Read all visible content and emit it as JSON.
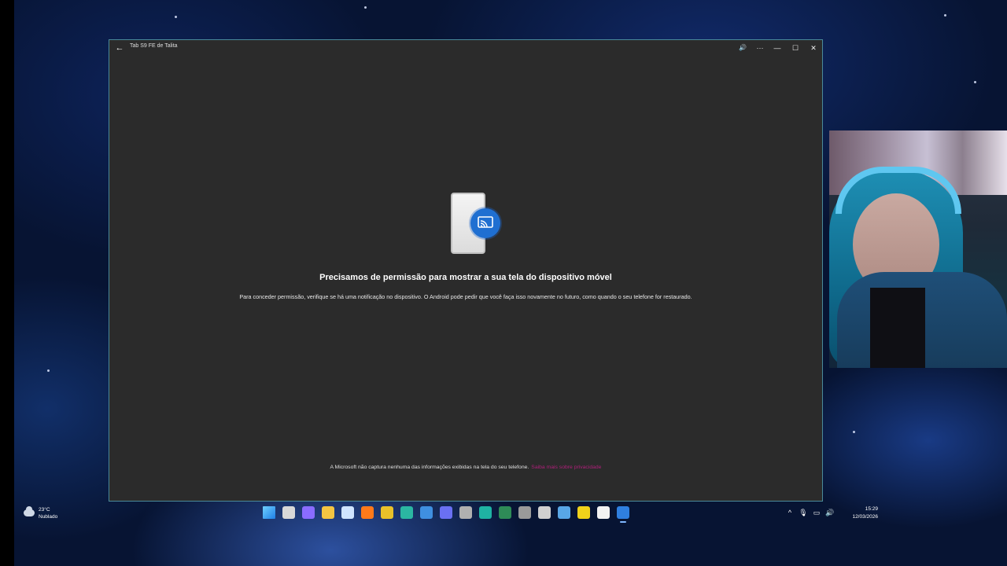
{
  "window": {
    "title": "Tab S9 FE de Talita",
    "back_glyph": "←",
    "controls": {
      "audio_glyph": "🔊",
      "more_glyph": "···",
      "minimize_glyph": "—",
      "maximize_glyph": "☐",
      "close_glyph": "✕"
    }
  },
  "main": {
    "illustration_icons": [
      "phone-icon",
      "cast-icon"
    ],
    "accent_color": "#1f6fd1",
    "headline": "Precisamos de permissão para mostrar a sua tela do dispositivo móvel",
    "subtext": "Para conceder permissão, verifique se há uma notificação no dispositivo. O Android pode pedir que você faça isso novamente no futuro, como quando o seu telefone for restaurado.",
    "footer_note": "A Microsoft não captura nenhuma das informações exibidas na tela do seu telefone.",
    "footer_link": "Saiba mais sobre privacidade"
  },
  "taskbar": {
    "weather": {
      "temperature": "23°C",
      "condition": "Nublado",
      "icon": "cloud-icon"
    },
    "apps": [
      {
        "name": "start-icon",
        "color": "#3aa0ff"
      },
      {
        "name": "task-view-icon",
        "color": "#d8d8d8"
      },
      {
        "name": "copilot-icon",
        "color": "#8a6cff"
      },
      {
        "name": "file-explorer-icon",
        "color": "#f4c542"
      },
      {
        "name": "steam-icon",
        "color": "#cfe4ff"
      },
      {
        "name": "firefox-icon",
        "color": "#ff7a1a"
      },
      {
        "name": "chrome-icon",
        "color": "#e8c12a"
      },
      {
        "name": "edge-icon",
        "color": "#2bb6a2"
      },
      {
        "name": "phone-link-icon",
        "color": "#3f8fe0"
      },
      {
        "name": "discord-icon",
        "color": "#6a70f2"
      },
      {
        "name": "game-icon",
        "color": "#b0b0b0"
      },
      {
        "name": "app-icon",
        "color": "#1fb3a3"
      },
      {
        "name": "topaz-icon",
        "color": "#2e8b57"
      },
      {
        "name": "tool-icon",
        "color": "#9a9a9a"
      },
      {
        "name": "image-icon",
        "color": "#d0d0d0"
      },
      {
        "name": "capture-icon",
        "color": "#58a6e6"
      },
      {
        "name": "sticky-notes-icon",
        "color": "#f0d21a"
      },
      {
        "name": "notepad-icon",
        "color": "#f2f2f2"
      },
      {
        "name": "phone-link-active-icon",
        "color": "#2f7fe0"
      }
    ],
    "tray_icons": [
      {
        "name": "chevron-up-icon",
        "glyph": "^"
      },
      {
        "name": "microphone-icon",
        "glyph": "🎙"
      },
      {
        "name": "network-icon",
        "glyph": "▭"
      },
      {
        "name": "volume-icon",
        "glyph": "🔊"
      }
    ],
    "time": "15:29",
    "date": "12/03/2026"
  }
}
